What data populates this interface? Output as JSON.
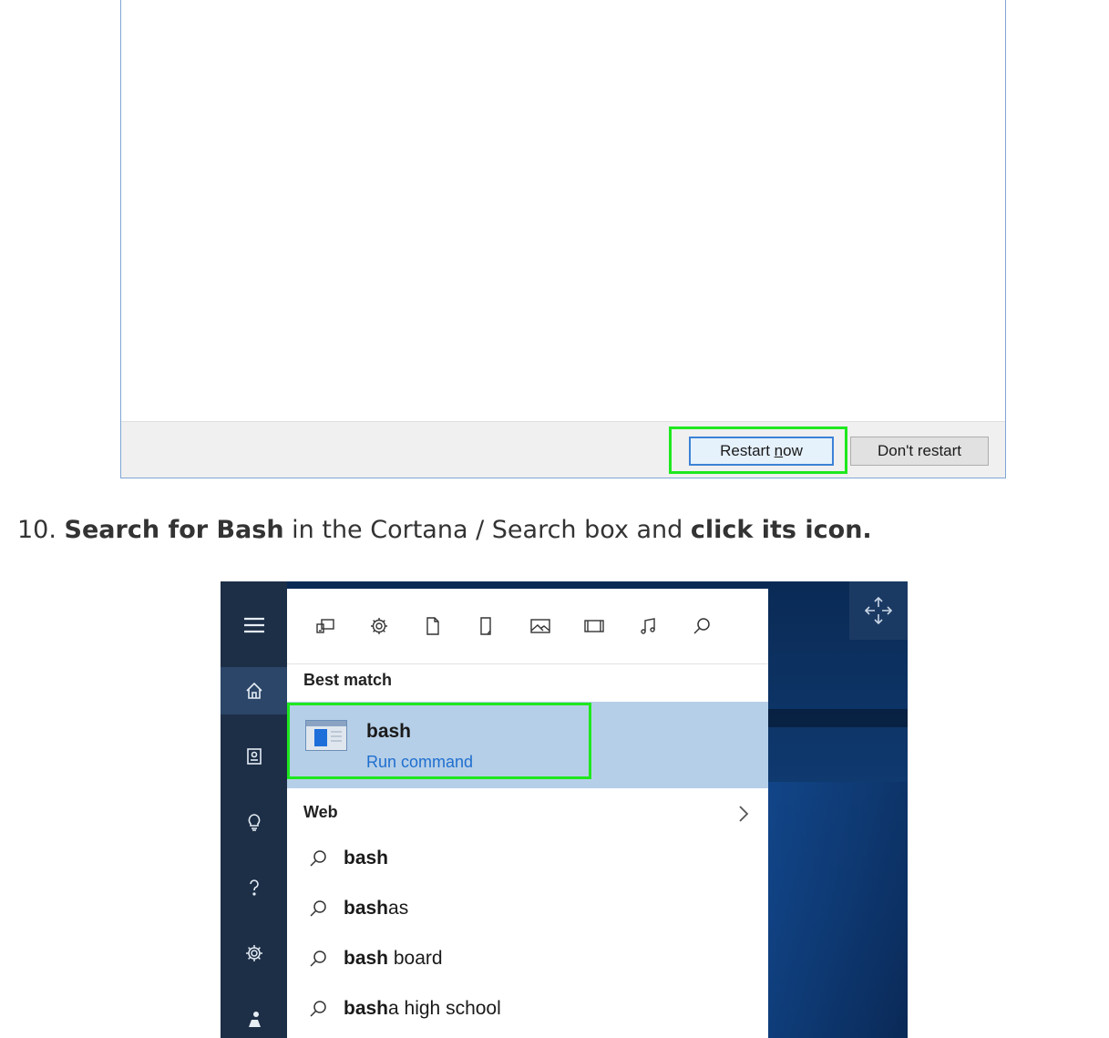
{
  "dialog": {
    "restart_button": "Restart now",
    "restart_button_pre": "Restart ",
    "restart_button_mnemonic": "n",
    "restart_button_post": "ow",
    "dont_restart_button": "Don't restart"
  },
  "step": {
    "number": "10.",
    "bold1": "Search for Bash",
    "mid": " in the Cortana / Search box and ",
    "bold2": "click its icon."
  },
  "search": {
    "filters": [
      "apps-icon",
      "settings-icon",
      "documents-icon",
      "folders-icon",
      "photos-icon",
      "videos-icon",
      "music-icon",
      "search-icon"
    ],
    "best_match_title": "Best match",
    "best_match": {
      "name": "bash",
      "subtitle": "Run command"
    },
    "web_title": "Web",
    "web_results": [
      {
        "bold": "bash",
        "rest": ""
      },
      {
        "bold": "bash",
        "rest": "as"
      },
      {
        "bold": "bash",
        "rest": " board"
      },
      {
        "bold": "bash",
        "rest": "a high school"
      }
    ],
    "rail": [
      "menu-icon",
      "home-icon",
      "notebook-icon",
      "tips-icon",
      "help-icon",
      "settings-icon",
      "feedback-icon"
    ]
  },
  "colors": {
    "highlight": "#1ee81e",
    "selected_row": "#b6cfe8",
    "rail": "#1d2f47",
    "link": "#1f6fcf"
  }
}
